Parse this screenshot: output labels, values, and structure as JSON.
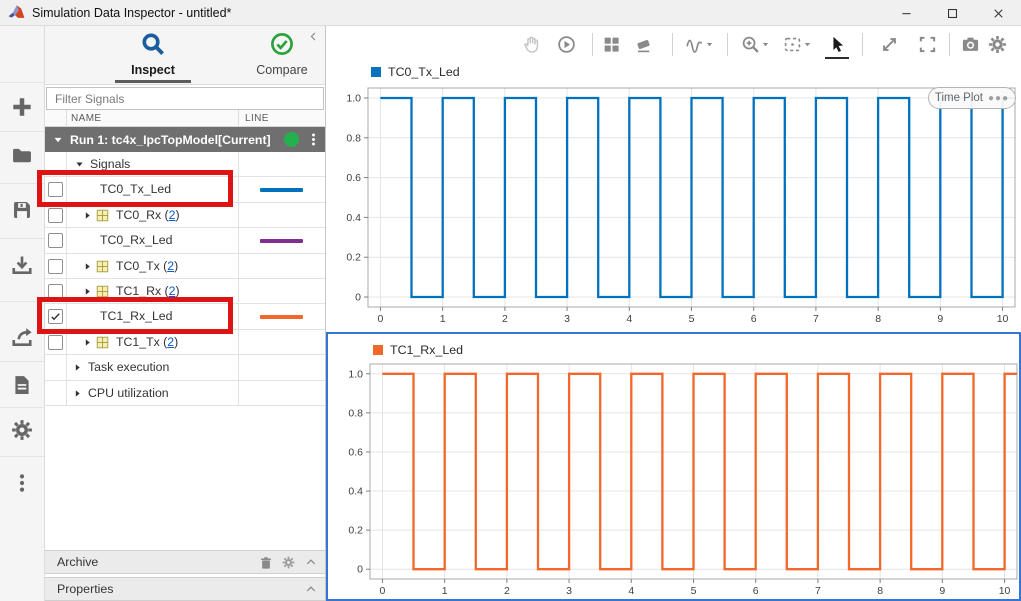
{
  "window": {
    "title": "Simulation Data Inspector - untitled*",
    "controls": [
      {
        "name": "minimize",
        "icon": "minimize"
      },
      {
        "name": "maximize",
        "icon": "maximize"
      },
      {
        "name": "close",
        "icon": "close"
      }
    ]
  },
  "left_toolbar": {
    "items": [
      {
        "name": "new",
        "icon": "plus"
      },
      {
        "name": "open",
        "icon": "folder"
      },
      {
        "name": "save",
        "icon": "save"
      },
      {
        "name": "import",
        "icon": "import"
      },
      {
        "name": "export",
        "icon": "export"
      },
      {
        "name": "create-report",
        "icon": "report"
      },
      {
        "name": "preferences",
        "icon": "gear"
      },
      {
        "name": "more-options",
        "icon": "ellipsis-v"
      }
    ]
  },
  "sidebar": {
    "tabs": [
      {
        "label": "Inspect",
        "icon": "search",
        "icon_color": "#1d5c9e",
        "active": true
      },
      {
        "label": "Compare",
        "icon": "check-circle",
        "icon_color": "#2ba23c",
        "active": false
      }
    ],
    "filter_placeholder": "Filter Signals",
    "columns": [
      "NAME",
      "LINE"
    ],
    "run_header": {
      "label": "Run 1: tc4x_IpcTopModel[Current]",
      "status_color": "#22b14c"
    },
    "rows": [
      {
        "type": "group",
        "label": "Signals",
        "expanded": true
      },
      {
        "type": "signal",
        "label": "TC0_Tx_Led",
        "checked": false,
        "line_color": "#0072BD"
      },
      {
        "type": "bus",
        "label": "TC0_Rx",
        "count": "2",
        "checked": false
      },
      {
        "type": "signal",
        "label": "TC0_Rx_Led",
        "checked": false,
        "line_color": "#7E2F8E"
      },
      {
        "type": "bus",
        "label": "TC0_Tx",
        "count": "2",
        "checked": false
      },
      {
        "type": "bus",
        "label": "TC1_Rx",
        "count": "2",
        "checked": false
      },
      {
        "type": "signal",
        "label": "TC1_Rx_Led",
        "checked": true,
        "line_color": "#F2672A"
      },
      {
        "type": "bus",
        "label": "TC1_Tx",
        "count": "2",
        "checked": false
      },
      {
        "type": "category",
        "label": "Task execution"
      },
      {
        "type": "category",
        "label": "CPU utilization"
      }
    ],
    "archive": {
      "label": "Archive"
    },
    "properties": {
      "label": "Properties"
    }
  },
  "plot_toolbar": {
    "items": [
      {
        "name": "pan",
        "icon": "hand",
        "disabled": true
      },
      {
        "name": "replay",
        "icon": "replay"
      },
      {
        "sep": true
      },
      {
        "name": "subplot-layout",
        "icon": "layout"
      },
      {
        "name": "clear-plots",
        "icon": "eraser"
      },
      {
        "sep": true
      },
      {
        "name": "signal-display",
        "icon": "wave",
        "caret": true
      },
      {
        "sep": true
      },
      {
        "name": "zoom",
        "icon": "zoom-in",
        "caret": true
      },
      {
        "name": "fit-to-view",
        "icon": "fit-view",
        "caret": true
      },
      {
        "name": "pointer",
        "icon": "cursor",
        "selected": true
      },
      {
        "sep": true
      },
      {
        "name": "expand",
        "icon": "expand"
      },
      {
        "name": "maximize-plot",
        "icon": "fullscreen"
      },
      {
        "sep": true
      },
      {
        "name": "snapshot",
        "icon": "camera"
      },
      {
        "name": "visualization-settings",
        "icon": "gear"
      }
    ]
  },
  "colors": {
    "selection": "#3575d3",
    "annotation": "#de1414"
  },
  "annotations": [
    {
      "target": "TC0_Tx_Led",
      "color": "#de1414"
    },
    {
      "target": "TC1_Rx_Led",
      "color": "#de1414"
    }
  ],
  "chart_data": [
    {
      "type": "line",
      "title": "TC0_Tx_Led",
      "color": "#0072BD",
      "badge": "Time Plot",
      "xlim": [
        -0.2,
        10.2
      ],
      "ylim": [
        -0.05,
        1.05
      ],
      "x_ticks": [
        0,
        1,
        2,
        3,
        4,
        5,
        6,
        7,
        8,
        9,
        10
      ],
      "y_ticks": [
        0,
        0.2,
        0.4,
        0.6,
        0.8,
        1.0
      ],
      "y_tick_labels": [
        "0",
        "0.2",
        "0.4",
        "0.6",
        "0.8",
        "1.0"
      ],
      "grid": true,
      "points": [
        [
          0,
          1
        ],
        [
          0.5,
          1
        ],
        [
          0.5,
          0
        ],
        [
          1,
          0
        ],
        [
          1,
          1
        ],
        [
          1.5,
          1
        ],
        [
          1.5,
          0
        ],
        [
          2,
          0
        ],
        [
          2,
          1
        ],
        [
          2.5,
          1
        ],
        [
          2.5,
          0
        ],
        [
          3,
          0
        ],
        [
          3,
          1
        ],
        [
          3.5,
          1
        ],
        [
          3.5,
          0
        ],
        [
          4,
          0
        ],
        [
          4,
          1
        ],
        [
          4.5,
          1
        ],
        [
          4.5,
          0
        ],
        [
          5,
          0
        ],
        [
          5,
          1
        ],
        [
          5.5,
          1
        ],
        [
          5.5,
          0
        ],
        [
          6,
          0
        ],
        [
          6,
          1
        ],
        [
          6.5,
          1
        ],
        [
          6.5,
          0
        ],
        [
          7,
          0
        ],
        [
          7,
          1
        ],
        [
          7.5,
          1
        ],
        [
          7.5,
          0
        ],
        [
          8,
          0
        ],
        [
          8,
          1
        ],
        [
          8.5,
          1
        ],
        [
          8.5,
          0
        ],
        [
          9,
          0
        ],
        [
          9,
          1
        ],
        [
          9.5,
          1
        ],
        [
          9.5,
          0
        ],
        [
          10,
          0
        ],
        [
          10,
          1
        ],
        [
          10.2,
          1
        ]
      ]
    },
    {
      "type": "line",
      "title": "TC1_Rx_Led",
      "color": "#F2672A",
      "badge": null,
      "selected": true,
      "xlim": [
        -0.2,
        10.2
      ],
      "ylim": [
        -0.05,
        1.05
      ],
      "x_ticks": [
        0,
        1,
        2,
        3,
        4,
        5,
        6,
        7,
        8,
        9,
        10
      ],
      "y_ticks": [
        0,
        0.2,
        0.4,
        0.6,
        0.8,
        1.0
      ],
      "y_tick_labels": [
        "0",
        "0.2",
        "0.4",
        "0.6",
        "0.8",
        "1.0"
      ],
      "grid": true,
      "points": [
        [
          0,
          1
        ],
        [
          0.5,
          1
        ],
        [
          0.5,
          0
        ],
        [
          1,
          0
        ],
        [
          1,
          1
        ],
        [
          1.5,
          1
        ],
        [
          1.5,
          0
        ],
        [
          2,
          0
        ],
        [
          2,
          1
        ],
        [
          2.5,
          1
        ],
        [
          2.5,
          0
        ],
        [
          3,
          0
        ],
        [
          3,
          1
        ],
        [
          3.5,
          1
        ],
        [
          3.5,
          0
        ],
        [
          4,
          0
        ],
        [
          4,
          1
        ],
        [
          4.5,
          1
        ],
        [
          4.5,
          0
        ],
        [
          5,
          0
        ],
        [
          5,
          1
        ],
        [
          5.5,
          1
        ],
        [
          5.5,
          0
        ],
        [
          6,
          0
        ],
        [
          6,
          1
        ],
        [
          6.5,
          1
        ],
        [
          6.5,
          0
        ],
        [
          7,
          0
        ],
        [
          7,
          1
        ],
        [
          7.5,
          1
        ],
        [
          7.5,
          0
        ],
        [
          8,
          0
        ],
        [
          8,
          1
        ],
        [
          8.5,
          1
        ],
        [
          8.5,
          0
        ],
        [
          9,
          0
        ],
        [
          9,
          1
        ],
        [
          9.5,
          1
        ],
        [
          9.5,
          0
        ],
        [
          10,
          0
        ],
        [
          10,
          1
        ],
        [
          10.2,
          1
        ]
      ]
    }
  ]
}
